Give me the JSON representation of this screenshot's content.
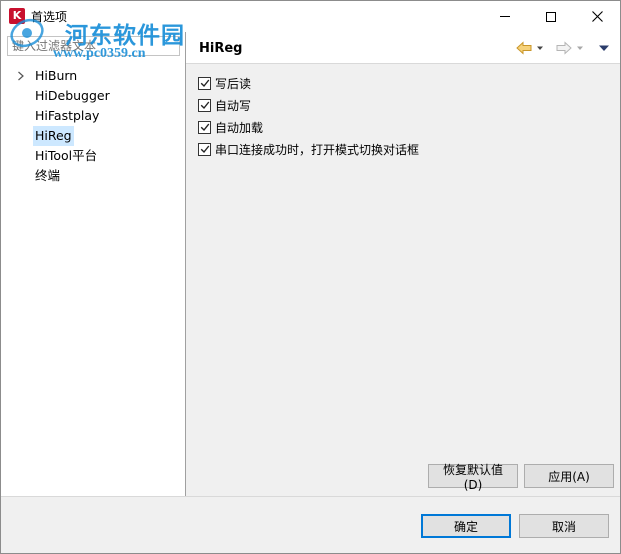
{
  "window": {
    "title": "首选项",
    "app_icon_glyph": "K",
    "controls": {
      "minimize": "minimize",
      "maximize": "maximize",
      "close": "close"
    }
  },
  "watermark": {
    "title": "河东软件园",
    "url": "www.pc0359.cn",
    "color": "#1a8fd8"
  },
  "filter": {
    "placeholder": "键入过滤器文本"
  },
  "tree": {
    "items": [
      {
        "label": "HiBurn",
        "expandable": true,
        "selected": false
      },
      {
        "label": "HiDebugger",
        "expandable": false,
        "selected": false
      },
      {
        "label": "HiFastplay",
        "expandable": false,
        "selected": false
      },
      {
        "label": "HiReg",
        "expandable": false,
        "selected": true
      },
      {
        "label": "HiTool平台",
        "expandable": false,
        "selected": false
      },
      {
        "label": "终端",
        "expandable": false,
        "selected": false
      }
    ]
  },
  "page": {
    "title": "HiReg",
    "options": [
      {
        "label": "写后读",
        "checked": true
      },
      {
        "label": "自动写",
        "checked": true
      },
      {
        "label": "自动加载",
        "checked": true
      },
      {
        "label": "串口连接成功时，打开模式切换对话框",
        "checked": true
      }
    ],
    "restore_defaults_label": "恢复默认值(D)",
    "apply_label": "应用(A)"
  },
  "footer": {
    "ok_label": "确定",
    "cancel_label": "取消"
  },
  "colors": {
    "selection": "#cde8ff",
    "default_button_border": "#0078d7",
    "nav_arrow": "#e8b84a",
    "app_icon": "#c8102e"
  }
}
